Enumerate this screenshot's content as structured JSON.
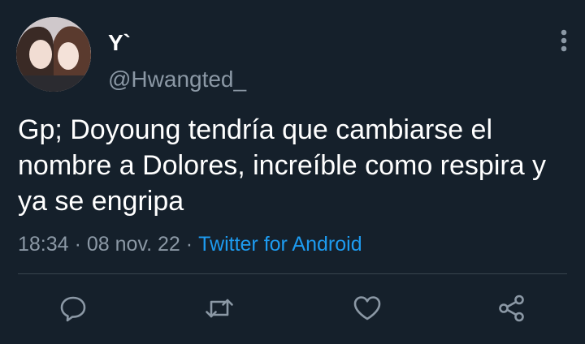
{
  "user": {
    "display_name": "Y`",
    "handle": "@Hwangted_"
  },
  "tweet": {
    "text": "Gp; Doyoung tendría que cambiarse el nombre a Dolores, increíble como respira y ya se engripa",
    "time": "18:34",
    "date": "08 nov. 22",
    "separator": "·",
    "source": "Twitter for Android"
  },
  "actions": {
    "reply_icon": "reply-icon",
    "retweet_icon": "retweet-icon",
    "like_icon": "like-icon",
    "share_icon": "share-icon",
    "more_icon": "more-vertical-icon"
  },
  "colors": {
    "background": "#15202b",
    "text": "#ffffff",
    "secondary_text": "#8b98a5",
    "link": "#1d9bf0",
    "divider": "#38444d"
  }
}
